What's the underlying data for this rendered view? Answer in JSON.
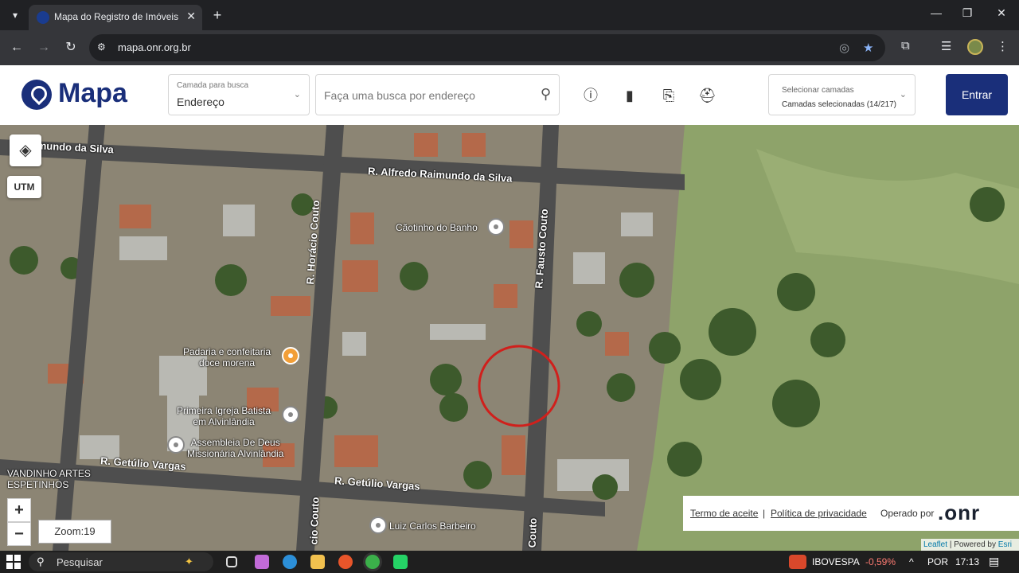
{
  "browser": {
    "tab_title": "Mapa do Registro de Imóveis",
    "url": "mapa.onr.org.br"
  },
  "header": {
    "logo": "Mapa",
    "layer_select": {
      "label": "Camada para busca",
      "value": "Endereço"
    },
    "search_placeholder": "Faça uma busca por endereço",
    "camadas": {
      "label": "Selecionar camadas",
      "value": "Camadas selecionadas (14/217)"
    },
    "login_label": "Entrar"
  },
  "map": {
    "utm_label": "UTM",
    "zoom_in": "+",
    "zoom_out": "−",
    "zoom_label": "Zoom:19",
    "streets": [
      "o Raimundo da Silva",
      "R. Alfredo Raimundo da Silva",
      "R. Horácio Couto",
      "R. Fausto Couto",
      "R. Getúlio Vargas",
      "R. Getúlio Vargas",
      "cio Couto",
      "Couto"
    ],
    "pois": {
      "caotinho": "Cãotinho do Banho",
      "padaria": [
        "Padaria e confeitaria",
        "doce morena"
      ],
      "igreja": [
        "Primeira Igreja Batista",
        "em Alvinlândia"
      ],
      "assembleia": [
        "Assembleia De Deus",
        "Missionária Alvinlândia"
      ],
      "vandinho": [
        "VANDINHO ARTES",
        "ESPETINHOS"
      ],
      "luiz": "Luiz Carlos Barbeiro"
    },
    "footer": {
      "termo": "Termo de aceite",
      "privacidade": "Política de privacidade",
      "separator": "|",
      "operado": "Operado por",
      "onr": ".onr"
    },
    "attribution": {
      "leaflet": "Leaflet",
      "powered": "| Powered by",
      "esri": "Esri"
    },
    "highlight_color": "#d0201c"
  },
  "taskbar": {
    "search": "Pesquisar",
    "ticker_name": "IBOVESPA",
    "ticker_value": "-0,59%",
    "language": "POR",
    "time": "17:13"
  }
}
